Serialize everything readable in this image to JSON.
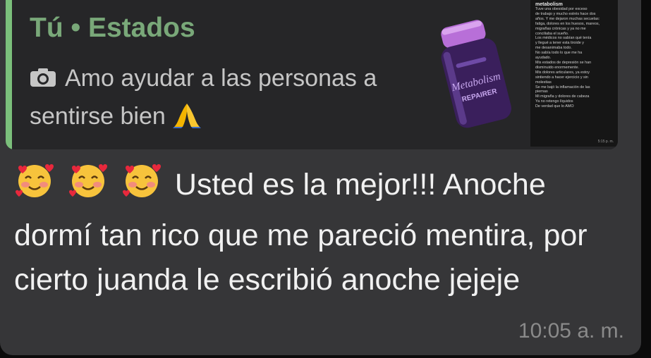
{
  "quoted_status": {
    "title": "Tú • Estados",
    "caption": "Amo ayudar a las personas a sentirse bien",
    "caption_emoji": "folded-hands-emoji",
    "thumbnail": {
      "title": "metabolism",
      "lines": [
        "Tuve una obesidad por exceso",
        "de trabajo y mucho estrés hace dos",
        "años. Y me dejaron muchas secuelas:",
        "fatiga, dolores en los huesos, mareos,",
        "migrañas crónicas y ya no me",
        "conciliaba el sueño.",
        "Los médicos no sabían qué tenía",
        "y llegué a tener esta tiroide y",
        "me desanimaba todo.",
        "No sabía todo lo que me ha",
        "ayudado.",
        "Mis estados de depresión se han",
        "disminuido enormemente.",
        "Mis dolores articulares, ya estoy",
        "sintiendo a hacer ejercicio y sin",
        "molestias",
        "Se me bajó la inflamación de las",
        "piernas",
        "Mi migraña y dolores de cabeza",
        "Ya no retengo líquidos",
        "De verdad que lo AMO"
      ],
      "time": "5:15 p. m."
    },
    "product_label": "Metabolism REPAIRER"
  },
  "message": {
    "emojis": [
      "smiling-face-with-hearts-emoji",
      "smiling-face-with-hearts-emoji",
      "smiling-face-with-hearts-emoji"
    ],
    "text": "Usted es la mejor!!! Anoche dormí tan rico que me pareció mentira, por cierto juanda le escribió anoche jejeje",
    "time": "10:05 a. m."
  },
  "colors": {
    "bubble": "#363638",
    "quote_bg": "#262628",
    "quote_bar": "#7bbf7b",
    "quote_title": "#79a879",
    "message_text": "#f1f1f1",
    "timestamp": "#8a8a8a"
  }
}
